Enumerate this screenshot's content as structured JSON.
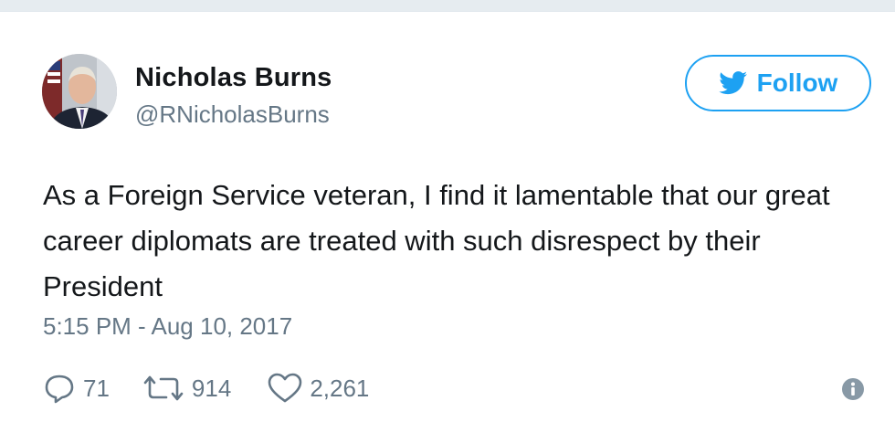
{
  "author": {
    "name": "Nicholas Burns",
    "handle": "@RNicholasBurns"
  },
  "follow_button": {
    "label": "Follow",
    "icon": "twitter-bird-icon"
  },
  "tweet": {
    "text": "As a Foreign Service veteran, I find it lamentable that our great career diplomats are treated with such disrespect by their President",
    "timestamp": "5:15 PM - Aug 10, 2017"
  },
  "actions": {
    "replies": "71",
    "retweets": "914",
    "likes": "2,261"
  },
  "colors": {
    "accent": "#1da1f2",
    "text": "#14171a",
    "muted": "#657786"
  }
}
